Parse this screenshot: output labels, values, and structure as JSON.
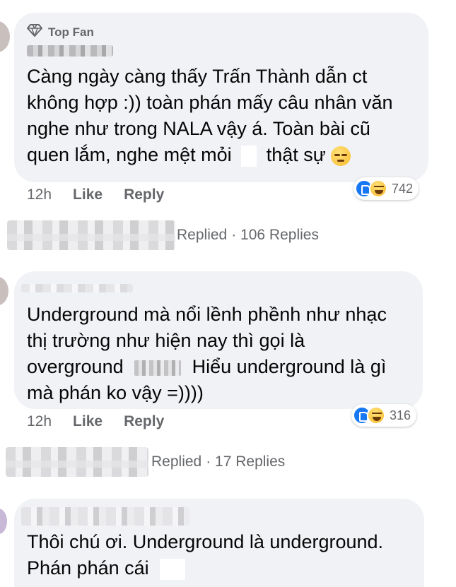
{
  "comments": [
    {
      "badge": "Top Fan",
      "lines": [
        "Càng ngày càng thấy Trấn Thành dẫn ct",
        "không hợp :)) toàn phán mấy câu nhân văn",
        "nghe như trong NALA vậy á. Toàn bài cũ",
        "quen lắm, nghe mệt mỏi",
        "thật sự"
      ],
      "emoji": "unamused-face",
      "time": "12h",
      "like": "Like",
      "reply": "Reply",
      "reaction_count": "742",
      "replied_label": "Replied",
      "replies_count": "· 106 Replies"
    },
    {
      "lines": [
        "Underground mà nổi lềnh phềnh như nhạc",
        "thị trường như hiện nay thì gọi là",
        "overground",
        "Hiểu underground là gì",
        "mà phán ko vậy =))))"
      ],
      "time": "12h",
      "like": "Like",
      "reply": "Reply",
      "reaction_count": "316",
      "replied_label": "Replied",
      "replies_count": "· 17 Replies"
    },
    {
      "lines": [
        "Thôi chú ơi. Underground là underground.",
        "Phán phán cái"
      ]
    }
  ],
  "reaction_icons": [
    "like-reaction-icon",
    "haha-reaction-icon"
  ],
  "colors": {
    "bubble": "#f0f2f5",
    "meta": "#65676b",
    "like_blue": "#1877f2"
  }
}
